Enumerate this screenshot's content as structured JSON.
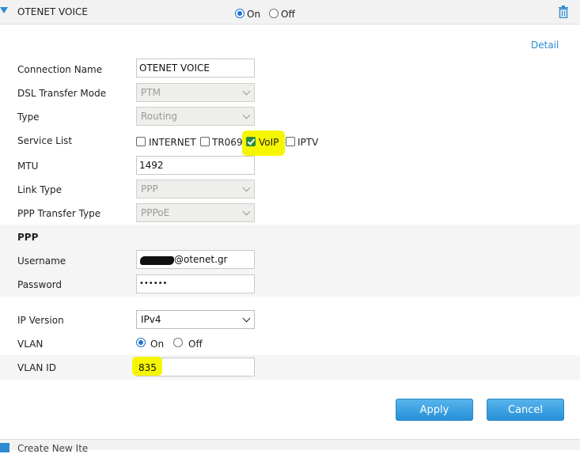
{
  "header": {
    "title": "OTENET VOICE",
    "on_label": "On",
    "off_label": "Off",
    "enabled": true
  },
  "detail_link": "Detail",
  "fields": {
    "connection_name": {
      "label": "Connection Name",
      "value": "OTENET VOICE"
    },
    "dsl_transfer_mode": {
      "label": "DSL Transfer Mode",
      "value": "PTM"
    },
    "type": {
      "label": "Type",
      "value": "Routing"
    },
    "service_list": {
      "label": "Service List",
      "options": [
        {
          "label": "INTERNET",
          "checked": false
        },
        {
          "label": "TR069",
          "checked": false
        },
        {
          "label": "VoIP",
          "checked": true
        },
        {
          "label": "IPTV",
          "checked": false
        }
      ]
    },
    "mtu": {
      "label": "MTU",
      "value": "1492"
    },
    "link_type": {
      "label": "Link Type",
      "value": "PPP"
    },
    "ppp_transfer_type": {
      "label": "PPP Transfer Type",
      "value": "PPPoE"
    }
  },
  "ppp": {
    "section_title": "PPP",
    "username": {
      "label": "Username",
      "value": "@otenet.gr"
    },
    "password": {
      "label": "Password",
      "value": "••••••"
    }
  },
  "ip": {
    "ip_version": {
      "label": "IP Version",
      "value": "IPv4"
    },
    "vlan": {
      "label": "VLAN",
      "on_label": "On",
      "off_label": "Off",
      "enabled": true
    },
    "vlan_id": {
      "label": "VLAN ID",
      "value": "835"
    }
  },
  "buttons": {
    "apply": "Apply",
    "cancel": "Cancel"
  },
  "footer": {
    "label": "Create New Ite"
  },
  "colors": {
    "accent": "#2c8bd2",
    "highlight": "#f6f600",
    "checkbox_checked": "#2a8a3c"
  }
}
